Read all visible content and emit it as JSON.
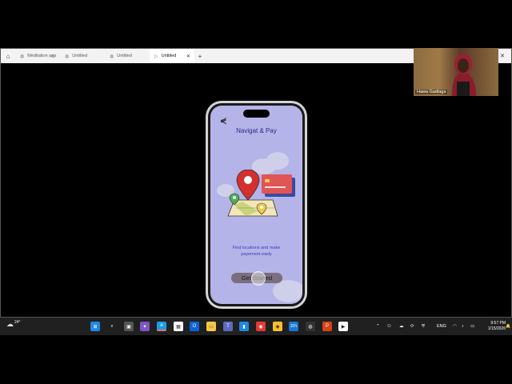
{
  "browser": {
    "tabs": [
      {
        "label": "Meditation app",
        "state": "loading"
      },
      {
        "label": "Untitled",
        "state": "normal"
      },
      {
        "label": "Untitled",
        "state": "normal"
      },
      {
        "label": "Untitled",
        "state": "active"
      }
    ],
    "new_tab": "+"
  },
  "phone_app": {
    "title": "Navigat & Pay",
    "tagline_line1": "Find locations and make",
    "tagline_line2": "payement easly",
    "cta_label": "Get Started",
    "colors": {
      "screen_bg": "#b4b4e8",
      "title": "#2a2a8a",
      "pin": "#d32f2f",
      "card": "#e05555",
      "cta": "#7b6f7f"
    }
  },
  "webcam": {
    "name": "Hawa Gadiaga"
  },
  "taskbar": {
    "weather_temp": "24°",
    "language": "ENG",
    "time": "9:57 PM",
    "date": "1/15/2026"
  }
}
